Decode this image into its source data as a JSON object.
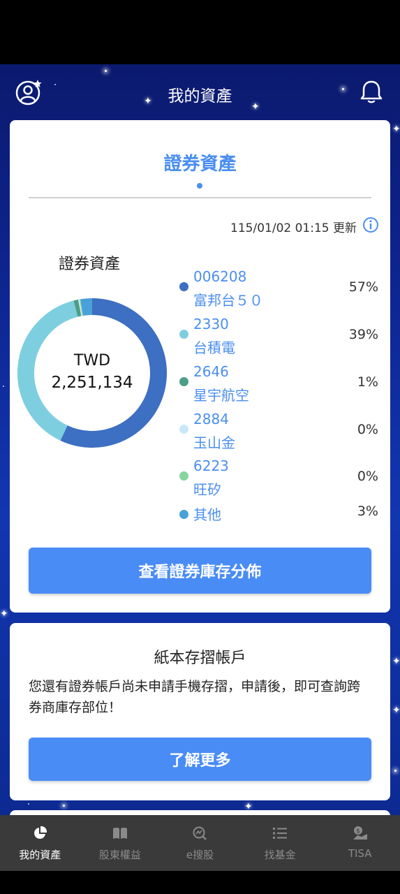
{
  "header": {
    "title": "我的資產",
    "profile_icon": "user-star-icon",
    "bell_icon": "bell-icon"
  },
  "asset_card": {
    "tab_title": "證券資產",
    "update_text": "115/01/02 01:15 更新",
    "info_icon": "info-icon",
    "section_label": "證券資產",
    "total_currency": "TWD",
    "total_amount": "2,251,134",
    "holdings": [
      {
        "code": "006208",
        "name": "富邦台５０",
        "percent": "57%",
        "share": 0.57,
        "color": "#3d6fc2"
      },
      {
        "code": "2330",
        "name": "台積電",
        "percent": "39%",
        "share": 0.39,
        "color": "#7dcfe0"
      },
      {
        "code": "2646",
        "name": "星宇航空",
        "percent": "1%",
        "share": 0.01,
        "color": "#4d9e86"
      },
      {
        "code": "2884",
        "name": "玉山金",
        "percent": "0%",
        "share": 0.003,
        "color": "#c8e8f8"
      },
      {
        "code": "6223",
        "name": "旺矽",
        "percent": "0%",
        "share": 0.002,
        "color": "#88d4a0"
      },
      {
        "code": "",
        "name": "其他",
        "percent": "3%",
        "share": 0.025,
        "color": "#4aa0d8"
      }
    ],
    "button_label": "查看證券庫存分佈"
  },
  "paper_card": {
    "title": "紙本存摺帳戶",
    "description": "您還有證券帳戶尚未申請手機存摺，申請後，即可查詢跨券商庫存部位！",
    "button_label": "了解更多"
  },
  "bottom_nav": [
    {
      "label": "我的資產",
      "icon": "pie-chart-icon",
      "active": true
    },
    {
      "label": "股東權益",
      "icon": "book-icon",
      "active": false
    },
    {
      "label": "e搜股",
      "icon": "search-chart-icon",
      "active": false
    },
    {
      "label": "找基金",
      "icon": "list-icon",
      "active": false
    },
    {
      "label": "TISA",
      "icon": "money-hand-icon",
      "active": false
    }
  ],
  "colors": {
    "accent": "#4a8ef0",
    "button": "#4a8cf6",
    "nav_bg": "#3a3a3a"
  }
}
